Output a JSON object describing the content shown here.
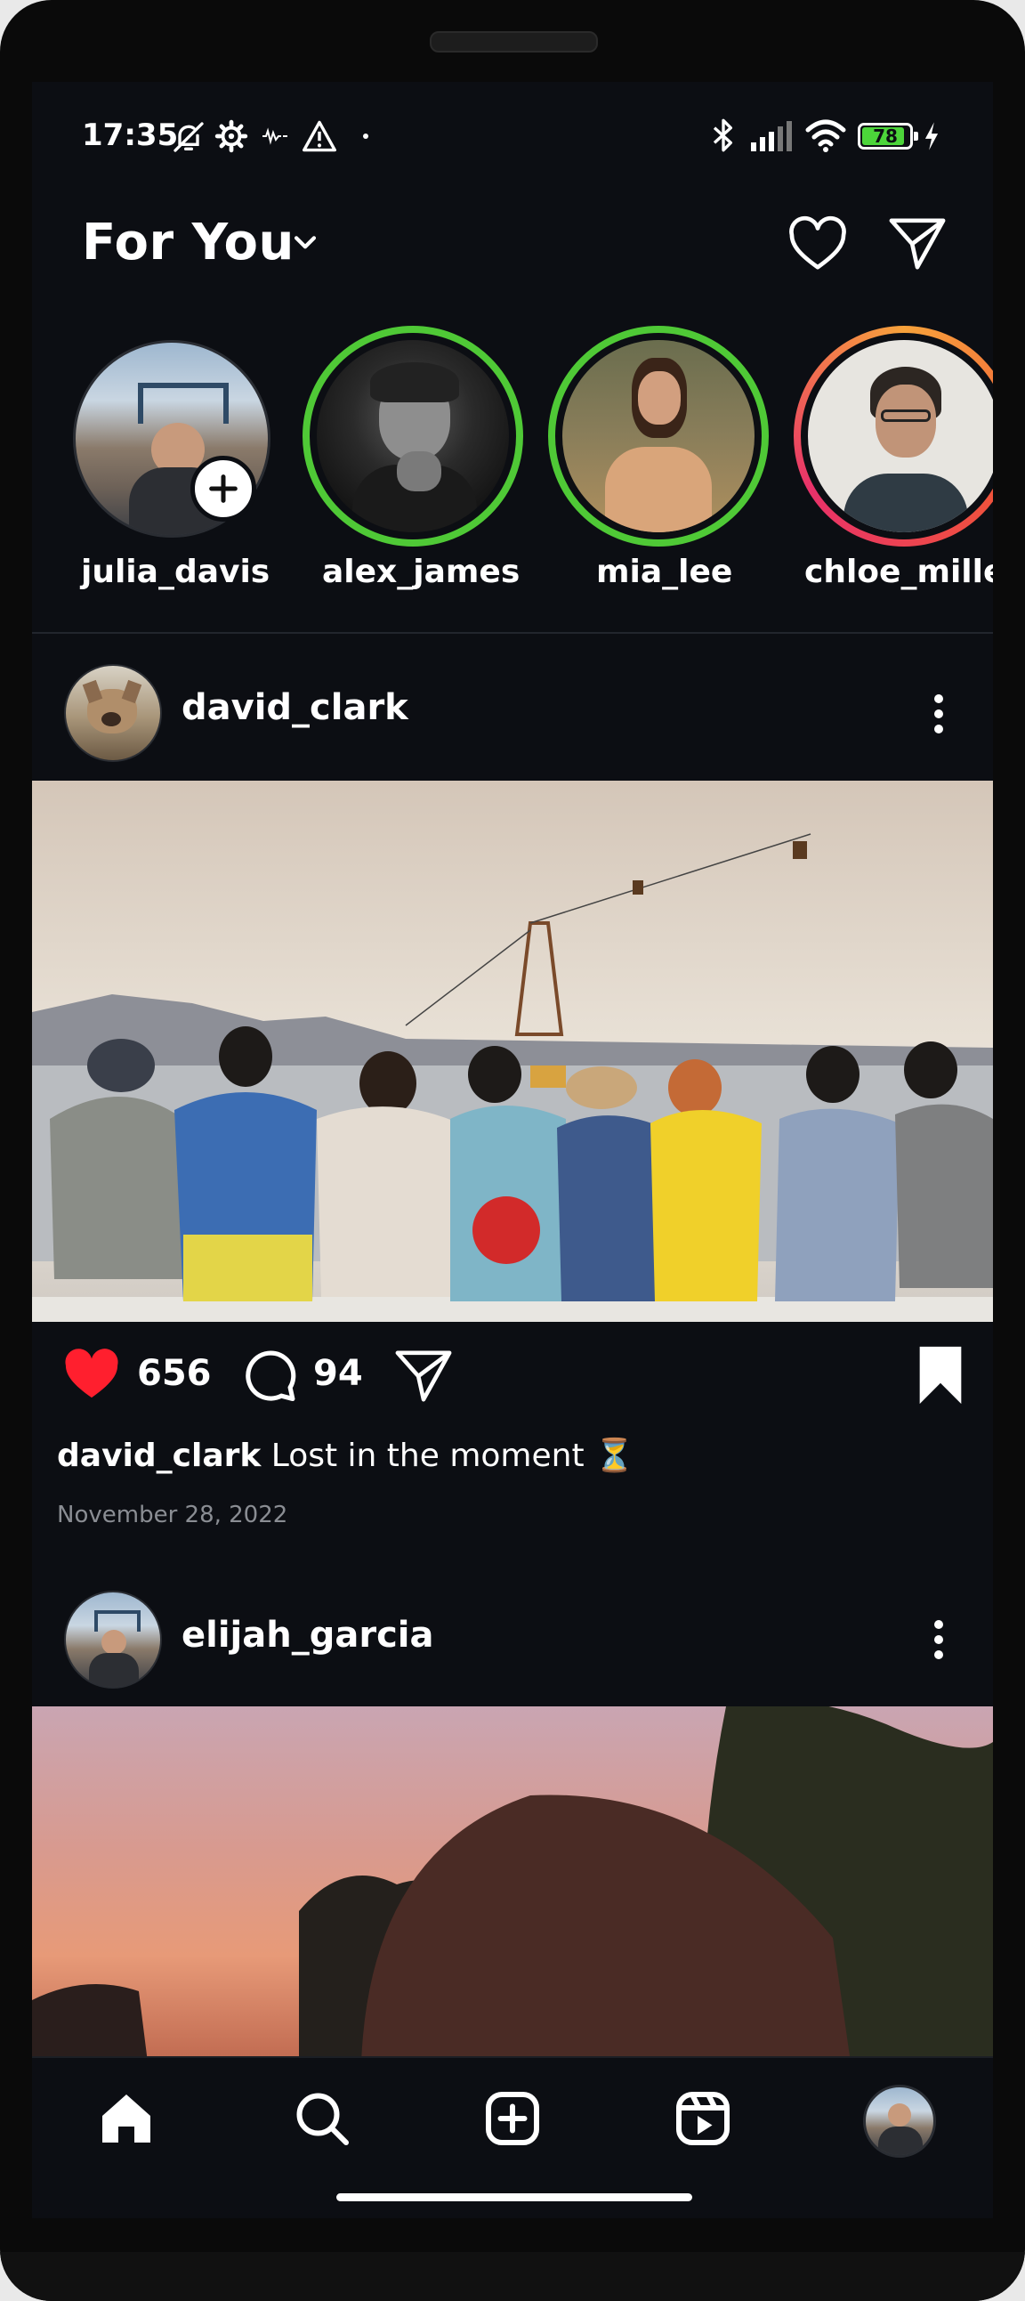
{
  "status_bar": {
    "time": "17:35",
    "battery": "78"
  },
  "header": {
    "title": "For You"
  },
  "stories": [
    {
      "username": "julia_davis",
      "ring": "none",
      "own": true
    },
    {
      "username": "alex_james",
      "ring": "green"
    },
    {
      "username": "mia_lee",
      "ring": "green"
    },
    {
      "username": "chloe_miller",
      "ring": "gradient"
    }
  ],
  "posts": [
    {
      "username": "david_clark",
      "likes": "656",
      "comments": "94",
      "caption_user": "david_clark",
      "caption_text": "Lost in the moment ⏳",
      "date": "November 28, 2022",
      "liked": true
    },
    {
      "username": "elijah_garcia"
    }
  ],
  "colors": {
    "background": "#0c0e13",
    "story_ring_green": "#4fc936",
    "like_red": "#ff1f2e"
  },
  "icons": {
    "status": [
      "muted-bell-icon",
      "settings-gear-icon",
      "vibrate-icon",
      "warning-icon",
      "dot-icon",
      "bluetooth-icon",
      "signal-icon",
      "wifi-icon",
      "battery-icon",
      "charging-icon"
    ],
    "header": [
      "chevron-down-icon",
      "heart-icon",
      "send-icon"
    ],
    "nav": [
      "home-icon",
      "search-icon",
      "add-post-icon",
      "reels-icon",
      "profile-avatar"
    ]
  }
}
